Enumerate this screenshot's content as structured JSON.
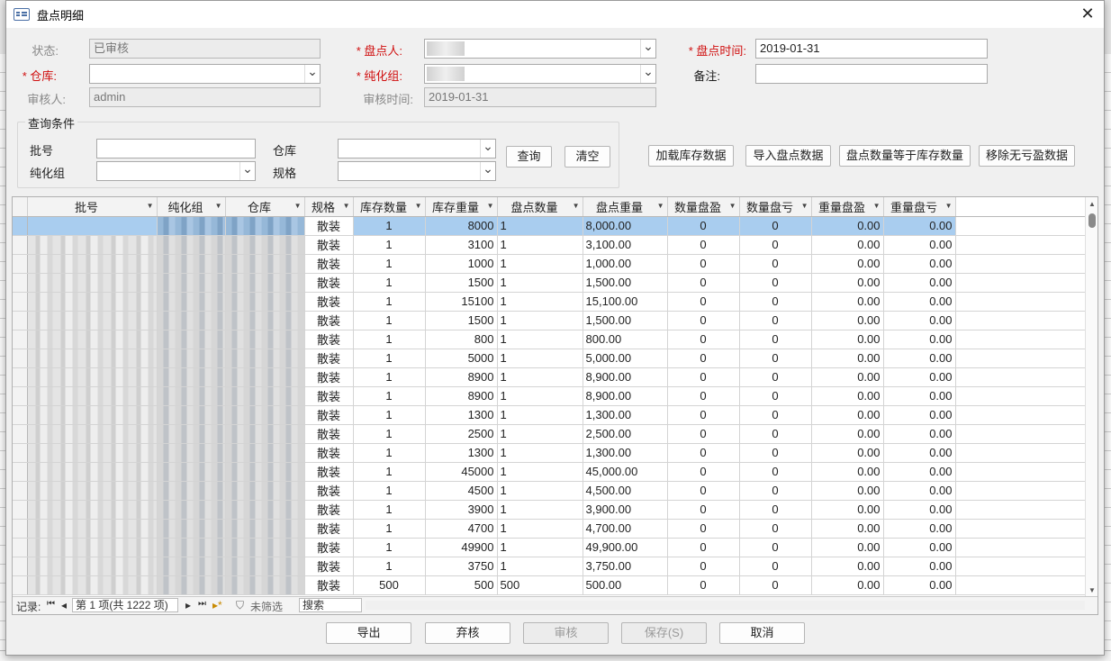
{
  "window": {
    "title": "盘点明细",
    "close_glyph": "✕"
  },
  "form": {
    "status_label": "状态:",
    "status_value": "已审核",
    "counter_label": "* 盘点人:",
    "counter_value": "",
    "count_time_label": "* 盘点时间:",
    "count_time_value": "2019-01-31",
    "warehouse_label": "* 仓库:",
    "warehouse_value": "",
    "group_label": "* 纯化组:",
    "group_value": "",
    "remark_label": "备注:",
    "remark_value": "",
    "auditor_label": "审核人:",
    "auditor_value": "admin",
    "audit_time_label": "审核时间:",
    "audit_time_value": "2019-01-31"
  },
  "query": {
    "title": "查询条件",
    "batch_label": "批号",
    "warehouse_label": "仓库",
    "group_label": "纯化组",
    "spec_label": "规格",
    "search_button": "查询",
    "clear_button": "清空"
  },
  "actions": {
    "load_stock": "加载库存数据",
    "import_count": "导入盘点数据",
    "count_equals_stock": "盘点数量等于库存数量",
    "remove_no_diff": "移除无亏盈数据"
  },
  "grid": {
    "headers": [
      "批号",
      "纯化组",
      "仓库",
      "规格",
      "库存数量",
      "库存重量",
      "盘点数量",
      "盘点重量",
      "数量盘盈",
      "数量盘亏",
      "重量盘盈",
      "重量盘亏"
    ],
    "rows": [
      [
        "散装",
        "1",
        "8000",
        "1",
        "8,000.00",
        "0",
        "0",
        "0.00",
        "0.00"
      ],
      [
        "散装",
        "1",
        "3100",
        "1",
        "3,100.00",
        "0",
        "0",
        "0.00",
        "0.00"
      ],
      [
        "散装",
        "1",
        "1000",
        "1",
        "1,000.00",
        "0",
        "0",
        "0.00",
        "0.00"
      ],
      [
        "散装",
        "1",
        "1500",
        "1",
        "1,500.00",
        "0",
        "0",
        "0.00",
        "0.00"
      ],
      [
        "散装",
        "1",
        "15100",
        "1",
        "15,100.00",
        "0",
        "0",
        "0.00",
        "0.00"
      ],
      [
        "散装",
        "1",
        "1500",
        "1",
        "1,500.00",
        "0",
        "0",
        "0.00",
        "0.00"
      ],
      [
        "散装",
        "1",
        "800",
        "1",
        "800.00",
        "0",
        "0",
        "0.00",
        "0.00"
      ],
      [
        "散装",
        "1",
        "5000",
        "1",
        "5,000.00",
        "0",
        "0",
        "0.00",
        "0.00"
      ],
      [
        "散装",
        "1",
        "8900",
        "1",
        "8,900.00",
        "0",
        "0",
        "0.00",
        "0.00"
      ],
      [
        "散装",
        "1",
        "8900",
        "1",
        "8,900.00",
        "0",
        "0",
        "0.00",
        "0.00"
      ],
      [
        "散装",
        "1",
        "1300",
        "1",
        "1,300.00",
        "0",
        "0",
        "0.00",
        "0.00"
      ],
      [
        "散装",
        "1",
        "2500",
        "1",
        "2,500.00",
        "0",
        "0",
        "0.00",
        "0.00"
      ],
      [
        "散装",
        "1",
        "1300",
        "1",
        "1,300.00",
        "0",
        "0",
        "0.00",
        "0.00"
      ],
      [
        "散装",
        "1",
        "45000",
        "1",
        "45,000.00",
        "0",
        "0",
        "0.00",
        "0.00"
      ],
      [
        "散装",
        "1",
        "4500",
        "1",
        "4,500.00",
        "0",
        "0",
        "0.00",
        "0.00"
      ],
      [
        "散装",
        "1",
        "3900",
        "1",
        "3,900.00",
        "0",
        "0",
        "0.00",
        "0.00"
      ],
      [
        "散装",
        "1",
        "4700",
        "1",
        "4,700.00",
        "0",
        "0",
        "0.00",
        "0.00"
      ],
      [
        "散装",
        "1",
        "49900",
        "1",
        "49,900.00",
        "0",
        "0",
        "0.00",
        "0.00"
      ],
      [
        "散装",
        "1",
        "3750",
        "1",
        "3,750.00",
        "0",
        "0",
        "0.00",
        "0.00"
      ],
      [
        "散装",
        "500",
        "500",
        "500",
        "500.00",
        "0",
        "0",
        "0.00",
        "0.00"
      ]
    ]
  },
  "navigator": {
    "record_label": "记录:",
    "record_value": "第 1 项(共 1222 项)",
    "filter_label": "未筛选",
    "search_label": "搜索",
    "first_glyph": "⏮",
    "prev_glyph": "◂",
    "next_glyph": "▸",
    "last_glyph": "⏭",
    "new_glyph": "▸*"
  },
  "footer": {
    "export": "导出",
    "unaudit": "弃核",
    "audit": "审核",
    "save": "保存(S)",
    "cancel": "取消"
  },
  "colors": {
    "required": "#d01010",
    "selected_row": "#a9cdef"
  }
}
